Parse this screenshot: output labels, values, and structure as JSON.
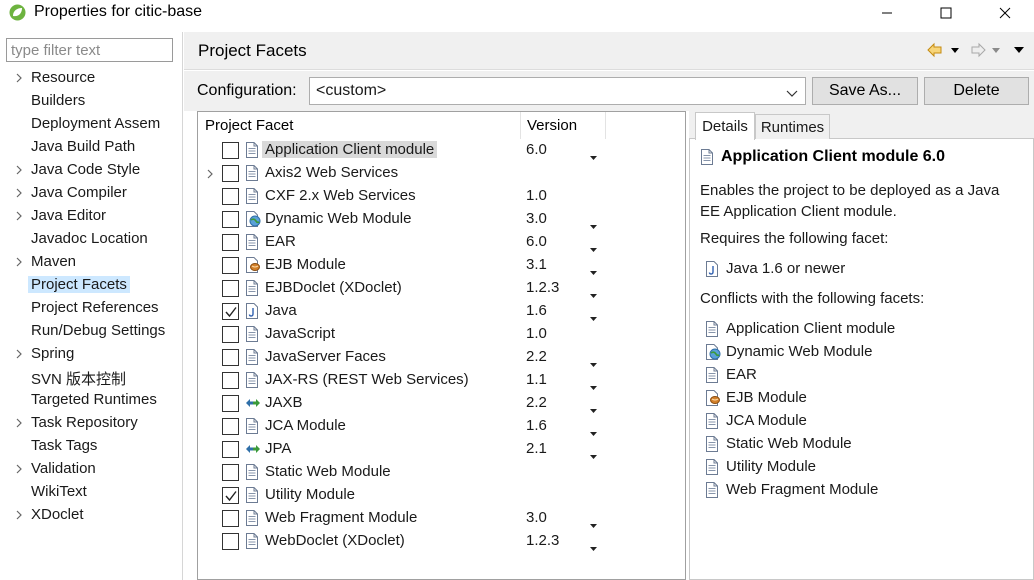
{
  "window": {
    "title": "Properties for citic-base"
  },
  "filter": {
    "placeholder": "type filter text"
  },
  "nav": {
    "items": [
      {
        "label": "Resource",
        "expandable": true
      },
      {
        "label": "Builders",
        "expandable": false
      },
      {
        "label": "Deployment Assem",
        "expandable": false
      },
      {
        "label": "Java Build Path",
        "expandable": false
      },
      {
        "label": "Java Code Style",
        "expandable": true
      },
      {
        "label": "Java Compiler",
        "expandable": true
      },
      {
        "label": "Java Editor",
        "expandable": true
      },
      {
        "label": "Javadoc Location",
        "expandable": false
      },
      {
        "label": "Maven",
        "expandable": true
      },
      {
        "label": "Project Facets",
        "expandable": false,
        "selected": true
      },
      {
        "label": "Project References",
        "expandable": false
      },
      {
        "label": "Run/Debug Settings",
        "expandable": false
      },
      {
        "label": "Spring",
        "expandable": true
      },
      {
        "label": "SVN 版本控制",
        "expandable": false
      },
      {
        "label": "Targeted Runtimes",
        "expandable": false
      },
      {
        "label": "Task Repository",
        "expandable": true
      },
      {
        "label": "Task Tags",
        "expandable": false
      },
      {
        "label": "Validation",
        "expandable": true
      },
      {
        "label": "WikiText",
        "expandable": false
      },
      {
        "label": "XDoclet",
        "expandable": true
      }
    ]
  },
  "header": {
    "title": "Project Facets"
  },
  "config": {
    "label": "Configuration:",
    "value": "<custom>",
    "save_as": "Save As...",
    "delete": "Delete"
  },
  "table": {
    "col_facet": "Project Facet",
    "col_version": "Version",
    "rows": [
      {
        "name": "Application Client module",
        "version": "6.0",
        "checked": false,
        "icon": "doc-icon",
        "dropdown": true,
        "selected": true,
        "expandable": false
      },
      {
        "name": "Axis2 Web Services",
        "version": "",
        "checked": false,
        "icon": "doc-icon",
        "dropdown": false,
        "expandable": true
      },
      {
        "name": "CXF 2.x Web Services",
        "version": "1.0",
        "checked": false,
        "icon": "doc-icon",
        "dropdown": false,
        "expandable": false
      },
      {
        "name": "Dynamic Web Module",
        "version": "3.0",
        "checked": false,
        "icon": "web-globe-icon",
        "dropdown": true,
        "expandable": false
      },
      {
        "name": "EAR",
        "version": "6.0",
        "checked": false,
        "icon": "doc-icon",
        "dropdown": true,
        "expandable": false
      },
      {
        "name": "EJB Module",
        "version": "3.1",
        "checked": false,
        "icon": "ejb-bean-icon",
        "dropdown": true,
        "expandable": false
      },
      {
        "name": "EJBDoclet (XDoclet)",
        "version": "1.2.3",
        "checked": false,
        "icon": "doc-icon",
        "dropdown": true,
        "expandable": false
      },
      {
        "name": "Java",
        "version": "1.6",
        "checked": true,
        "icon": "java-icon",
        "dropdown": true,
        "expandable": false
      },
      {
        "name": "JavaScript",
        "version": "1.0",
        "checked": false,
        "icon": "doc-icon",
        "dropdown": false,
        "expandable": false
      },
      {
        "name": "JavaServer Faces",
        "version": "2.2",
        "checked": false,
        "icon": "doc-icon",
        "dropdown": true,
        "expandable": false
      },
      {
        "name": "JAX-RS (REST Web Services)",
        "version": "1.1",
        "checked": false,
        "icon": "doc-icon",
        "dropdown": true,
        "expandable": false
      },
      {
        "name": "JAXB",
        "version": "2.2",
        "checked": false,
        "icon": "binding-arrows-icon",
        "dropdown": true,
        "expandable": false
      },
      {
        "name": "JCA Module",
        "version": "1.6",
        "checked": false,
        "icon": "doc-icon",
        "dropdown": true,
        "expandable": false
      },
      {
        "name": "JPA",
        "version": "2.1",
        "checked": false,
        "icon": "binding-arrows-icon",
        "dropdown": true,
        "expandable": false
      },
      {
        "name": "Static Web Module",
        "version": "",
        "checked": false,
        "icon": "doc-icon",
        "dropdown": false,
        "expandable": false
      },
      {
        "name": "Utility Module",
        "version": "",
        "checked": true,
        "icon": "doc-icon",
        "dropdown": false,
        "expandable": false
      },
      {
        "name": "Web Fragment Module",
        "version": "3.0",
        "checked": false,
        "icon": "doc-icon",
        "dropdown": true,
        "expandable": false
      },
      {
        "name": "WebDoclet (XDoclet)",
        "version": "1.2.3",
        "checked": false,
        "icon": "doc-icon",
        "dropdown": true,
        "expandable": false
      }
    ]
  },
  "details": {
    "tab_details": "Details",
    "tab_runtimes": "Runtimes",
    "title": "Application Client module 6.0",
    "description": "Enables the project to be deployed as a Java EE Application Client module.",
    "requires_label": "Requires the following facet:",
    "requires": [
      {
        "text": "Java 1.6 or newer",
        "icon": "java-icon"
      }
    ],
    "conflicts_label": "Conflicts with the following facets:",
    "conflicts": [
      {
        "text": "Application Client module",
        "icon": "doc-icon"
      },
      {
        "text": "Dynamic Web Module",
        "icon": "web-globe-icon"
      },
      {
        "text": "EAR",
        "icon": "doc-icon"
      },
      {
        "text": "EJB Module",
        "icon": "ejb-bean-icon"
      },
      {
        "text": "JCA Module",
        "icon": "doc-icon"
      },
      {
        "text": "Static Web Module",
        "icon": "doc-icon"
      },
      {
        "text": "Utility Module",
        "icon": "doc-icon"
      },
      {
        "text": "Web Fragment Module",
        "icon": "doc-icon"
      }
    ]
  },
  "colors": {
    "nav_selection": "#cde8ff",
    "row_selection": "#d9d9d9",
    "toolbar_bg": "#f0f0f0",
    "back_arrow": "#e8a317"
  }
}
